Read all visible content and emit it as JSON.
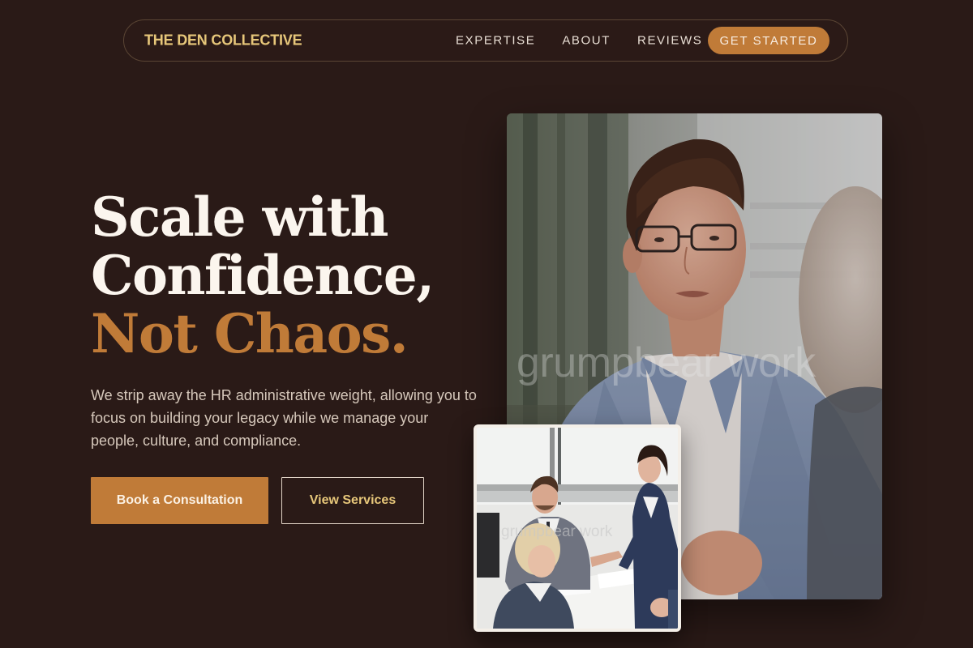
{
  "nav": {
    "brand": "THE DEN COLLECTIVE",
    "links": [
      {
        "label": "EXPERTISE"
      },
      {
        "label": "ABOUT"
      },
      {
        "label": "REVIEWS"
      }
    ],
    "cta_label": "GET STARTED"
  },
  "hero": {
    "headline_line1": "Scale with",
    "headline_line2": "Confidence,",
    "headline_accent": "Not Chaos.",
    "lede": "We strip away the HR administrative weight, allowing you to focus on building your legacy while we manage your people, culture, and compliance.",
    "primary_button": "Book a Consultation",
    "secondary_button": "View Services"
  },
  "images": {
    "main_watermark": "grumpbear work",
    "inset_watermark": "grumpbear work"
  },
  "colors": {
    "background": "#2a1a17",
    "accent": "#c07b38",
    "brand_gold": "#e7c77a",
    "text_light": "#fbf5ee"
  }
}
